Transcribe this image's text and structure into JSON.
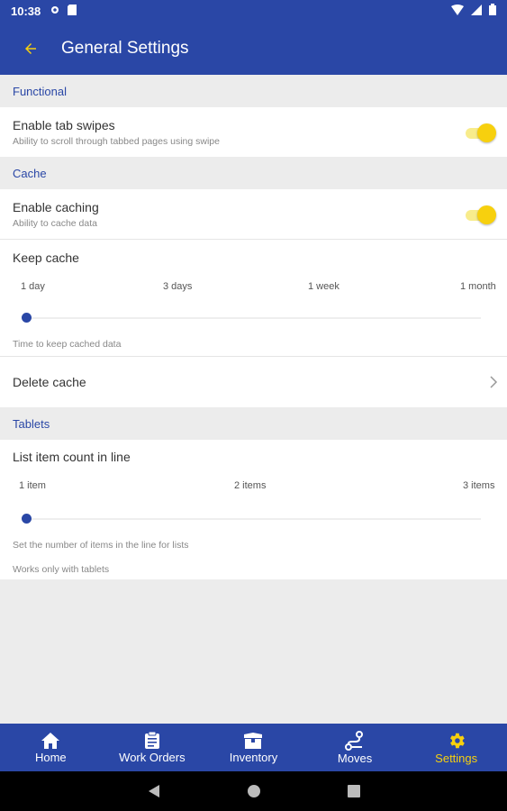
{
  "status": {
    "time": "10:38"
  },
  "appbar": {
    "title": "General Settings"
  },
  "sections": {
    "functional": "Functional",
    "cache": "Cache",
    "tablets": "Tablets"
  },
  "tab_swipes": {
    "title": "Enable tab swipes",
    "subtitle": "Ability to scroll through tabbed pages using swipe",
    "enabled": true
  },
  "caching": {
    "title": "Enable caching",
    "subtitle": "Ability to cache data",
    "enabled": true
  },
  "keep_cache": {
    "title": "Keep cache",
    "options": [
      "1 day",
      "3 days",
      "1 week",
      "1 month"
    ],
    "selected": "1 day",
    "help": "Time to keep cached data"
  },
  "delete_cache": {
    "title": "Delete cache"
  },
  "list_count": {
    "title": "List item count in line",
    "options": [
      "1 item",
      "2 items",
      "3 items"
    ],
    "selected": "1 item",
    "help1": "Set the number of items in the line for lists",
    "help2": "Works only with tablets"
  },
  "bottom_nav": {
    "items": [
      {
        "label": "Home",
        "icon": "home-icon"
      },
      {
        "label": "Work Orders",
        "icon": "clipboard-icon"
      },
      {
        "label": "Inventory",
        "icon": "box-icon"
      },
      {
        "label": "Moves",
        "icon": "route-icon"
      },
      {
        "label": "Settings",
        "icon": "gear-icon",
        "active": true
      }
    ]
  },
  "colors": {
    "primary": "#2a47a6",
    "accent": "#f7d00e",
    "background": "#ececec"
  }
}
